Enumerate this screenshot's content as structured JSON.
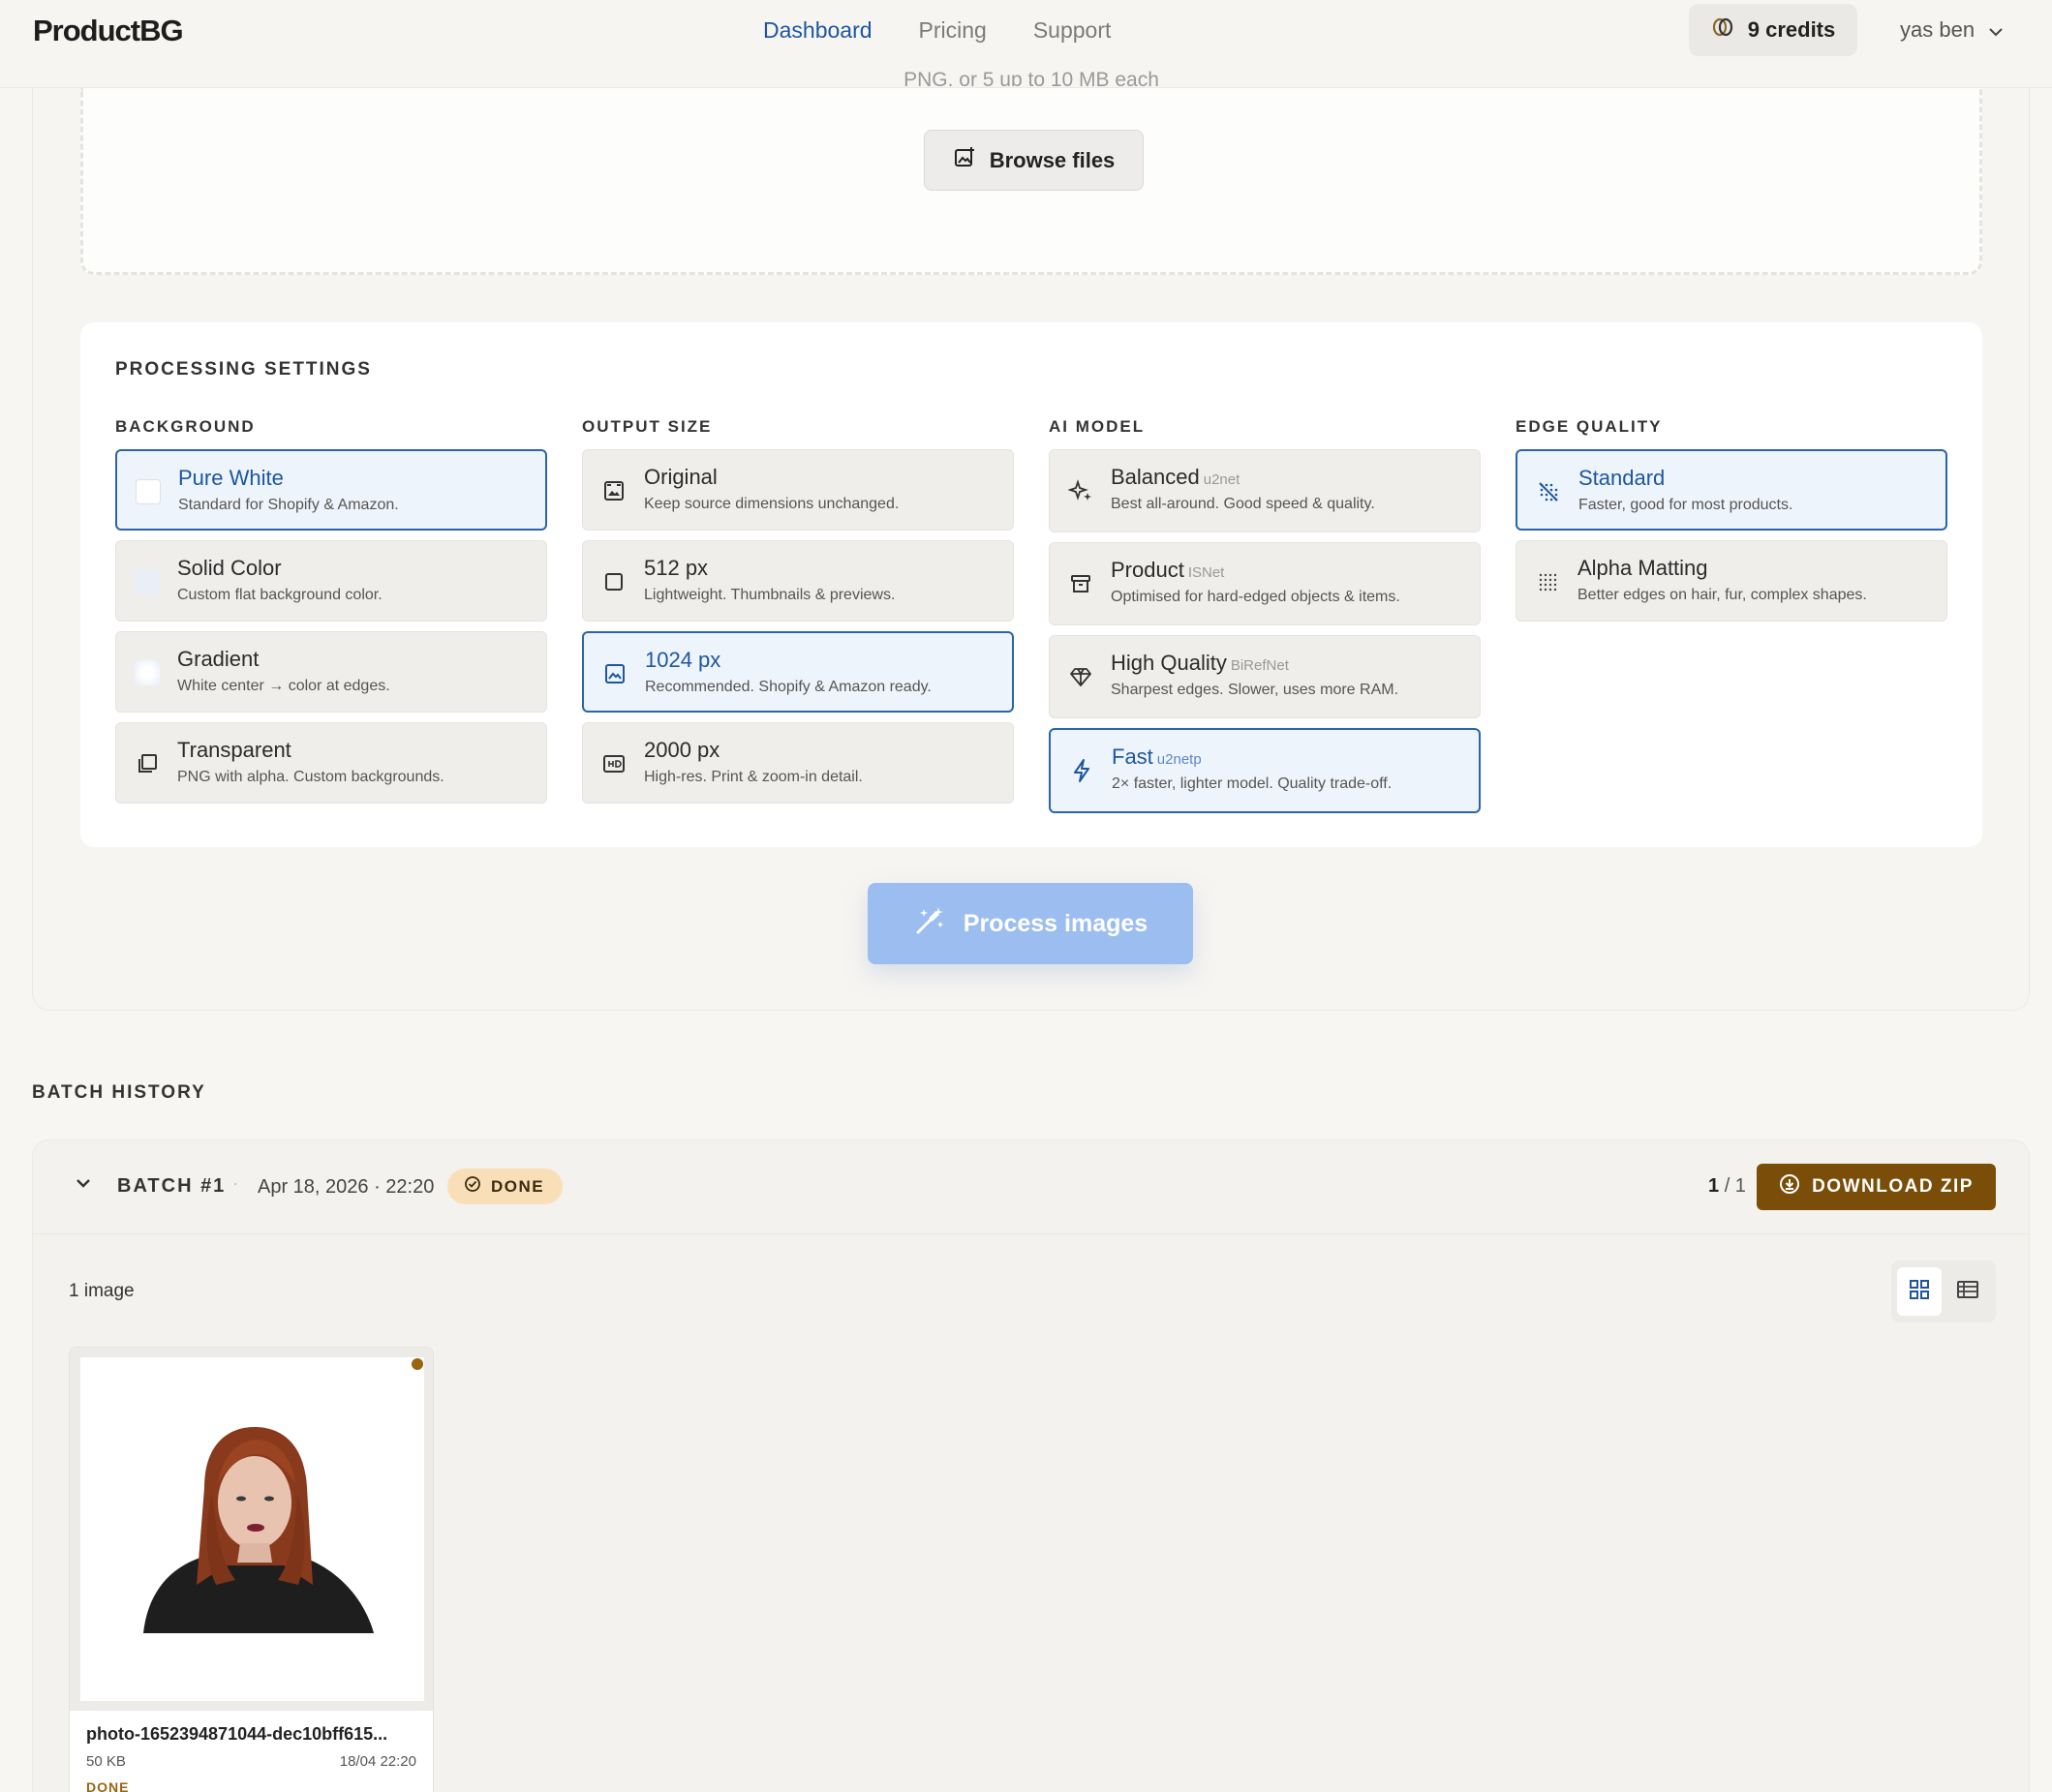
{
  "header": {
    "brand": "ProductBG",
    "nav": [
      {
        "label": "Dashboard",
        "active": true
      },
      {
        "label": "Pricing",
        "active": false
      },
      {
        "label": "Support",
        "active": false
      }
    ],
    "credits": "9 credits",
    "user": "yas ben"
  },
  "upload": {
    "hint": "PNG, or 5 up to 10 MB each",
    "browse_label": "Browse files"
  },
  "settings": {
    "title": "PROCESSING SETTINGS",
    "background": {
      "title": "BACKGROUND",
      "options": [
        {
          "name": "Pure White",
          "desc": "Standard for Shopify & Amazon.",
          "icon": "white-swatch",
          "selected": true
        },
        {
          "name": "Solid Color",
          "desc": "Custom flat background color.",
          "icon": "solid-swatch",
          "selected": false
        },
        {
          "name": "Gradient",
          "desc": "White center → color at edges.",
          "icon": "gradient-swatch",
          "selected": false
        },
        {
          "name": "Transparent",
          "desc": "PNG with alpha. Custom backgrounds.",
          "icon": "layers-icon",
          "selected": false
        }
      ]
    },
    "output_size": {
      "title": "OUTPUT SIZE",
      "options": [
        {
          "name": "Original",
          "desc": "Keep source dimensions unchanged.",
          "icon": "image-frame-icon",
          "selected": false
        },
        {
          "name": "512 px",
          "desc": "Lightweight. Thumbnails & previews.",
          "icon": "square-icon",
          "selected": false
        },
        {
          "name": "1024 px",
          "desc": "Recommended. Shopify & Amazon ready.",
          "icon": "image-icon",
          "selected": true
        },
        {
          "name": "2000 px",
          "desc": "High-res. Print & zoom-in detail.",
          "icon": "hd-icon",
          "selected": false
        }
      ]
    },
    "ai_model": {
      "title": "AI MODEL",
      "options": [
        {
          "name": "Balanced",
          "tag": "u2net",
          "desc": "Best all-around. Good speed & quality.",
          "icon": "sparkle-icon",
          "selected": false
        },
        {
          "name": "Product",
          "tag": "ISNet",
          "desc": "Optimised for hard-edged objects & items.",
          "icon": "archive-box-icon",
          "selected": false
        },
        {
          "name": "High Quality",
          "tag": "BiRefNet",
          "desc": "Sharpest edges. Slower, uses more RAM.",
          "icon": "diamond-icon",
          "selected": false
        },
        {
          "name": "Fast",
          "tag": "u2netp",
          "desc": "2× faster, lighter model. Quality trade-off.",
          "icon": "bolt-icon",
          "selected": true
        }
      ]
    },
    "edge_quality": {
      "title": "EDGE QUALITY",
      "options": [
        {
          "name": "Standard",
          "desc": "Faster, good for most products.",
          "icon": "dotted-grid-off-icon",
          "selected": true
        },
        {
          "name": "Alpha Matting",
          "desc": "Better edges on hair, fur, complex shapes.",
          "icon": "dotted-grid-icon",
          "selected": false
        }
      ]
    },
    "process_label": "Process images"
  },
  "history": {
    "title": "BATCH HISTORY",
    "batch": {
      "name": "BATCH #1",
      "separator": "·",
      "date": "Apr 18, 2026 · 22:20",
      "status": "DONE",
      "count_done": "1",
      "count_total": "/ 1",
      "download_label": "DOWNLOAD ZIP",
      "image_count": "1 image",
      "images": [
        {
          "filename": "photo-1652394871044-dec10bff615...",
          "size": "50 KB",
          "time": "18/04 22:20",
          "status": "DONE"
        }
      ]
    }
  },
  "colors": {
    "accent": "#1e56a0",
    "accent_light": "#9cbdef",
    "zip_button": "#7a4e08",
    "badge_done": "#f9dfb7"
  }
}
